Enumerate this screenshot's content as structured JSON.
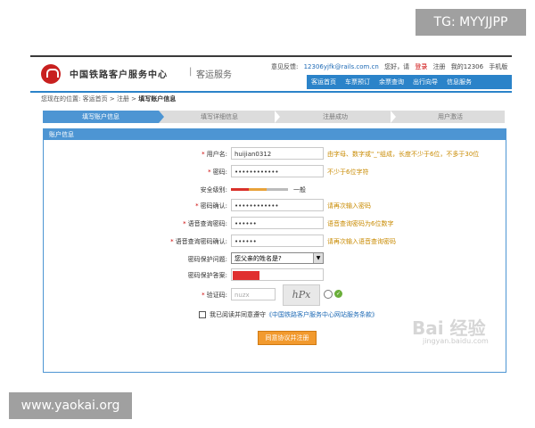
{
  "watermarks": {
    "tg": "TG: MYYJJPP",
    "site": "www.yaokai.org",
    "baidu": "Bai 经验",
    "baidu_sub": "jingyan.baidu.com"
  },
  "header": {
    "logo_title": "中国铁路客户服务中心",
    "logo_sep": "|",
    "logo_sub": "客运服务",
    "feedback": "意见反馈:",
    "feedback_email": "12306yjfk@rails.com.cn",
    "greeting": "您好，请",
    "login": "登录",
    "register": "注册",
    "mine": "我的12306",
    "phone": "手机版"
  },
  "nav": [
    "客运首页",
    "车票预订",
    "余票查询",
    "出行向导",
    "信息服务"
  ],
  "breadcrumb": {
    "prefix": "您现在的位置:",
    "home": "客运首页",
    "sep1": ">",
    "reg": "注册",
    "sep2": ">",
    "current": "填写账户信息"
  },
  "steps": [
    "填写账户信息",
    "填写详细信息",
    "注册成功",
    "用户激活"
  ],
  "panel_title": "账户信息",
  "form": {
    "username": {
      "label": "用户名:",
      "value": "huijian0312",
      "hint": "由字母、数字或\"_\"组成，长度不少于6位，不多于30位"
    },
    "password": {
      "label": "密码:",
      "value": "••••••••••••",
      "hint": "不少于6位字符"
    },
    "security": {
      "label": "安全级别:",
      "level": "一般"
    },
    "password_confirm": {
      "label": "密码确认:",
      "value": "••••••••••••",
      "hint": "请再次输入密码"
    },
    "query_password": {
      "label": "语音查询密码:",
      "value": "••••••",
      "hint": "语音查询密码为6位数字"
    },
    "query_password_confirm": {
      "label": "语音查询密码确认:",
      "value": "••••••",
      "hint": "请再次输入语音查询密码"
    },
    "question": {
      "label": "密码保护问题:",
      "value": "您父亲的姓名是?"
    },
    "answer": {
      "label": "密码保护答案:"
    },
    "captcha": {
      "label": "验证码:",
      "value": "nuzx",
      "image_text": "hPx"
    },
    "agree": {
      "text": "我已阅读并同意遵守",
      "link": "《中国铁路客户服务中心网站服务条款》"
    },
    "submit": "同意协议并注册"
  },
  "colors": {
    "accent": "#2b83c9",
    "hint": "#c88a00",
    "submit": "#f29a2e"
  }
}
